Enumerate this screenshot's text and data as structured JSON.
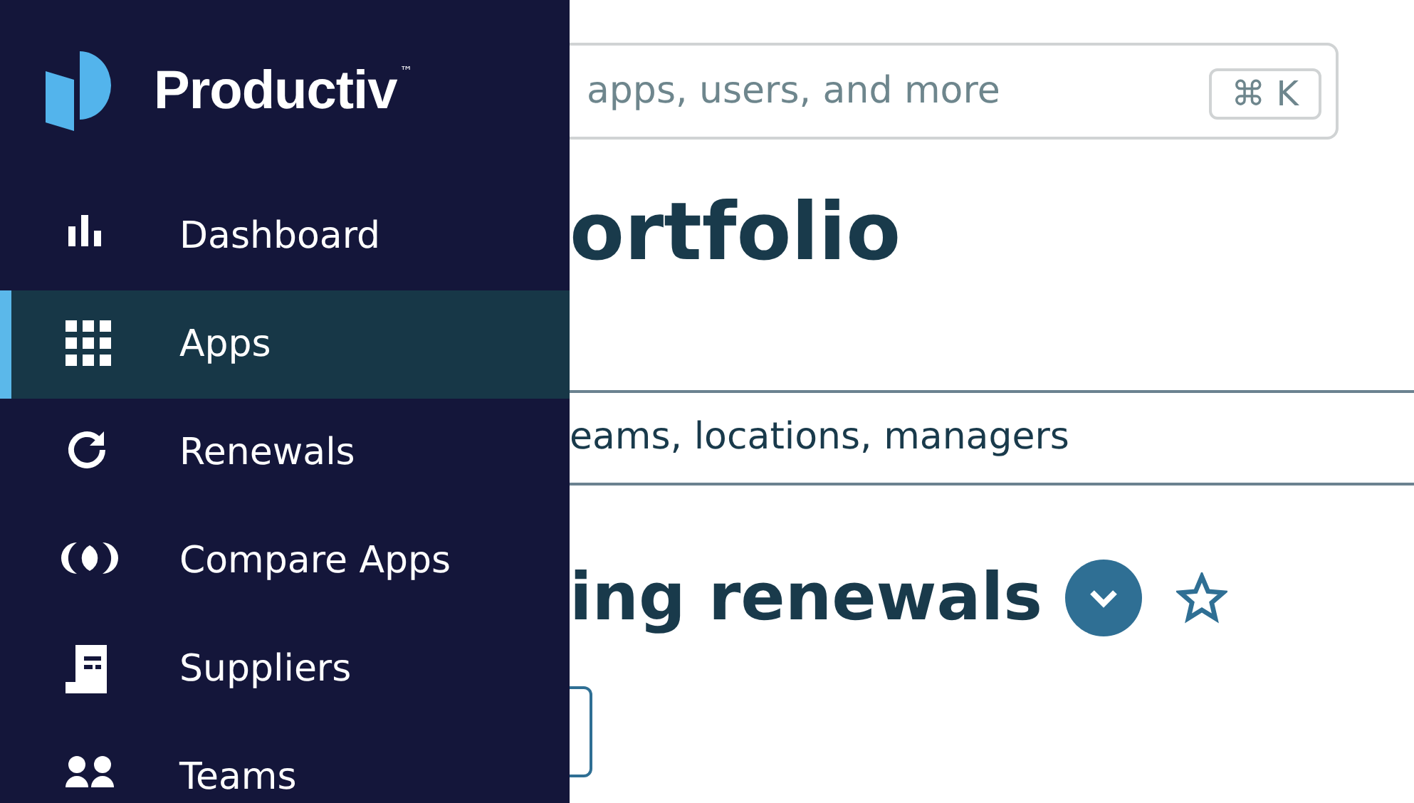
{
  "sidebar": {
    "brand": "Productiv",
    "trademark": "™",
    "items": [
      {
        "label": "Dashboard",
        "selected": false
      },
      {
        "label": "Apps",
        "selected": true
      },
      {
        "label": "Renewals",
        "selected": false
      },
      {
        "label": "Compare Apps",
        "selected": false
      },
      {
        "label": "Suppliers",
        "selected": false
      },
      {
        "label": "Teams",
        "selected": false
      }
    ]
  },
  "search": {
    "placeholder": "apps, users, and more",
    "shortcut": "⌘ K"
  },
  "page_title": "ortfolio",
  "filter_bar": {
    "text": "eams, locations, managers"
  },
  "section": {
    "title": "ing renewals",
    "expanded": false,
    "favorite": false
  }
}
